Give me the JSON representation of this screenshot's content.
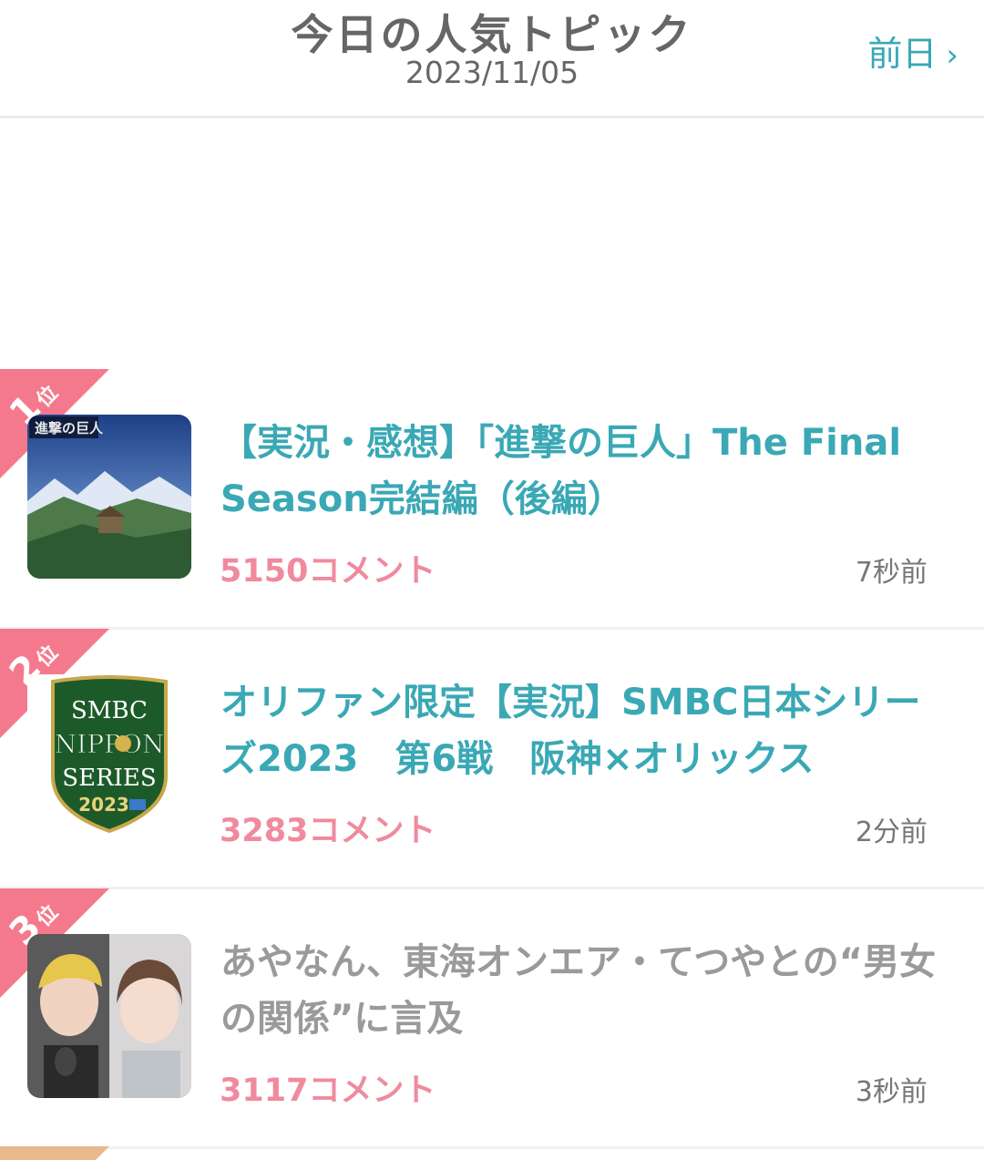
{
  "header": {
    "title": "今日の人気トピック",
    "date": "2023/11/05",
    "prev_label": "前日",
    "prev_icon": "chevron-right-icon"
  },
  "colors": {
    "accent": "#3aa8b5",
    "comment_pink": "#f08a9d",
    "rank_ribbon": "#f5798c",
    "visited_gray": "#9a9a9a"
  },
  "topics": [
    {
      "rank_num": "1",
      "rank_suffix": "位",
      "title": "【実況・感想】「進撃の巨人」The Final Season完結編（後編）",
      "comments": "5150コメント",
      "time": "7秒前",
      "state": "link"
    },
    {
      "rank_num": "2",
      "rank_suffix": "位",
      "title": "オリファン限定【実況】SMBC日本シリーズ2023　第6戦　阪神×オリックス",
      "comments": "3283コメント",
      "time": "2分前",
      "state": "link"
    },
    {
      "rank_num": "3",
      "rank_suffix": "位",
      "title": "あやなん、東海オンエア・てつやとの“男女の関係”に言及",
      "comments": "3117コメント",
      "time": "3秒前",
      "state": "visited"
    }
  ],
  "thumb2_logo": {
    "line1": "SMBC",
    "line2": "NIPPON",
    "line3": "SERIES",
    "line4": "2023"
  }
}
